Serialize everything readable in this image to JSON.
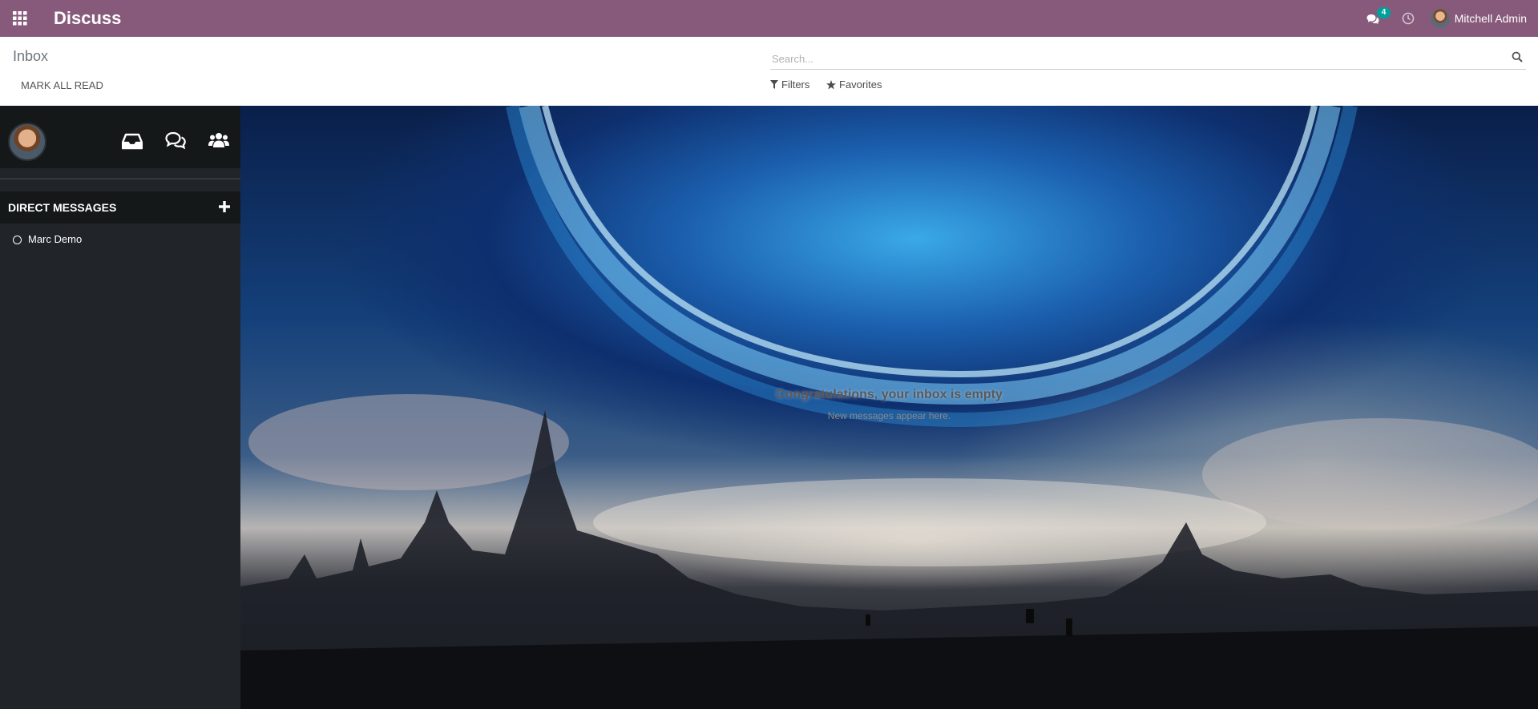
{
  "navbar": {
    "app_title": "Discuss",
    "message_count": "4",
    "user_name": "Mitchell Admin",
    "color": "#875a7b"
  },
  "control_panel": {
    "breadcrumb": "Inbox",
    "mark_all_read": "MARK ALL READ",
    "search_placeholder": "Search...",
    "filters_label": "Filters",
    "favorites_label": "Favorites"
  },
  "sidebar": {
    "icons": [
      "inbox-icon",
      "chat-icon",
      "users-icon"
    ],
    "direct_messages_title": "DIRECT MESSAGES",
    "direct_messages": [
      {
        "name": "Marc Demo",
        "status": "offline"
      }
    ]
  },
  "main": {
    "empty_title": "Congratulations, your inbox is empty",
    "empty_subtitle": "New messages appear here."
  }
}
